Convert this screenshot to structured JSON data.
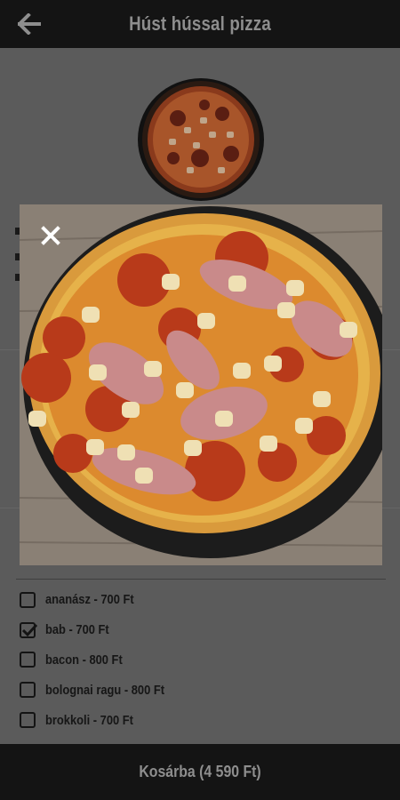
{
  "header": {
    "title": "Húst hússal pizza",
    "back_icon": "arrow-left-icon"
  },
  "modal": {
    "close_icon": "close-icon"
  },
  "options": [
    {
      "label": "ananász - 700 Ft",
      "checked": false
    },
    {
      "label": "bab - 700 Ft",
      "checked": true
    },
    {
      "label": "bacon - 800 Ft",
      "checked": false
    },
    {
      "label": "bolognai ragu - 800 Ft",
      "checked": false
    },
    {
      "label": "brokkoli - 700 Ft",
      "checked": false
    }
  ],
  "cart": {
    "label": "Kosárba (4 590 Ft)"
  },
  "colors": {
    "bar": "#141414",
    "overlay_bg": "#5b5b5b",
    "bar_text": "#8e8e8e"
  }
}
